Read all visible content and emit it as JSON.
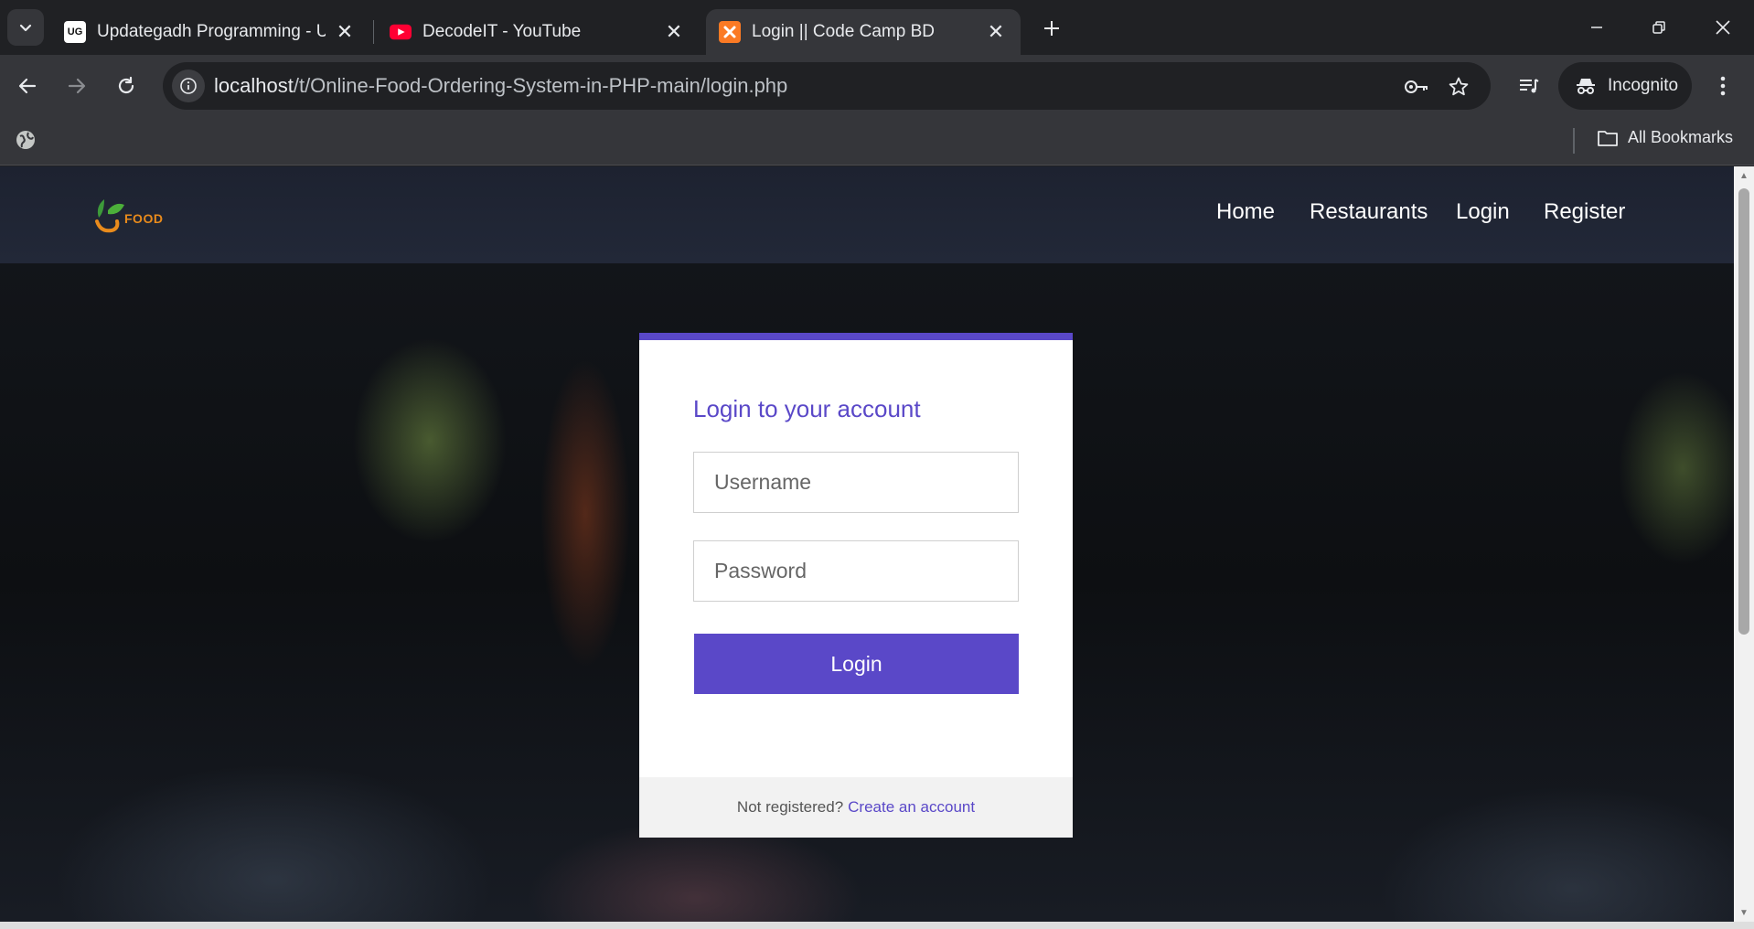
{
  "browser": {
    "tabs": [
      {
        "title": "Updategadh Programming - Up",
        "favicon": "UG",
        "active": false
      },
      {
        "title": "DecodeIT - YouTube",
        "favicon": "youtube-icon",
        "active": false
      },
      {
        "title": "Login || Code Camp BD",
        "favicon": "xampp-icon",
        "active": true
      }
    ],
    "url_host": "localhost",
    "url_path": "/t/Online-Food-Ordering-System-in-PHP-main/login.php",
    "incognito_label": "Incognito",
    "bookmarks_label": "All Bookmarks"
  },
  "site": {
    "logo_text": "FOOD",
    "nav": [
      "Home",
      "Restaurants",
      "Login",
      "Register"
    ]
  },
  "login": {
    "title": "Login to your account",
    "username_placeholder": "Username",
    "password_placeholder": "Password",
    "submit_label": "Login",
    "footer_text": "Not registered?",
    "footer_link": "Create an account"
  },
  "colors": {
    "accent": "#5a48c8",
    "logo_orange": "#e98b1c",
    "logo_green": "#3d9a3a",
    "chrome_dark": "#202124",
    "chrome_mid": "#35363a"
  }
}
